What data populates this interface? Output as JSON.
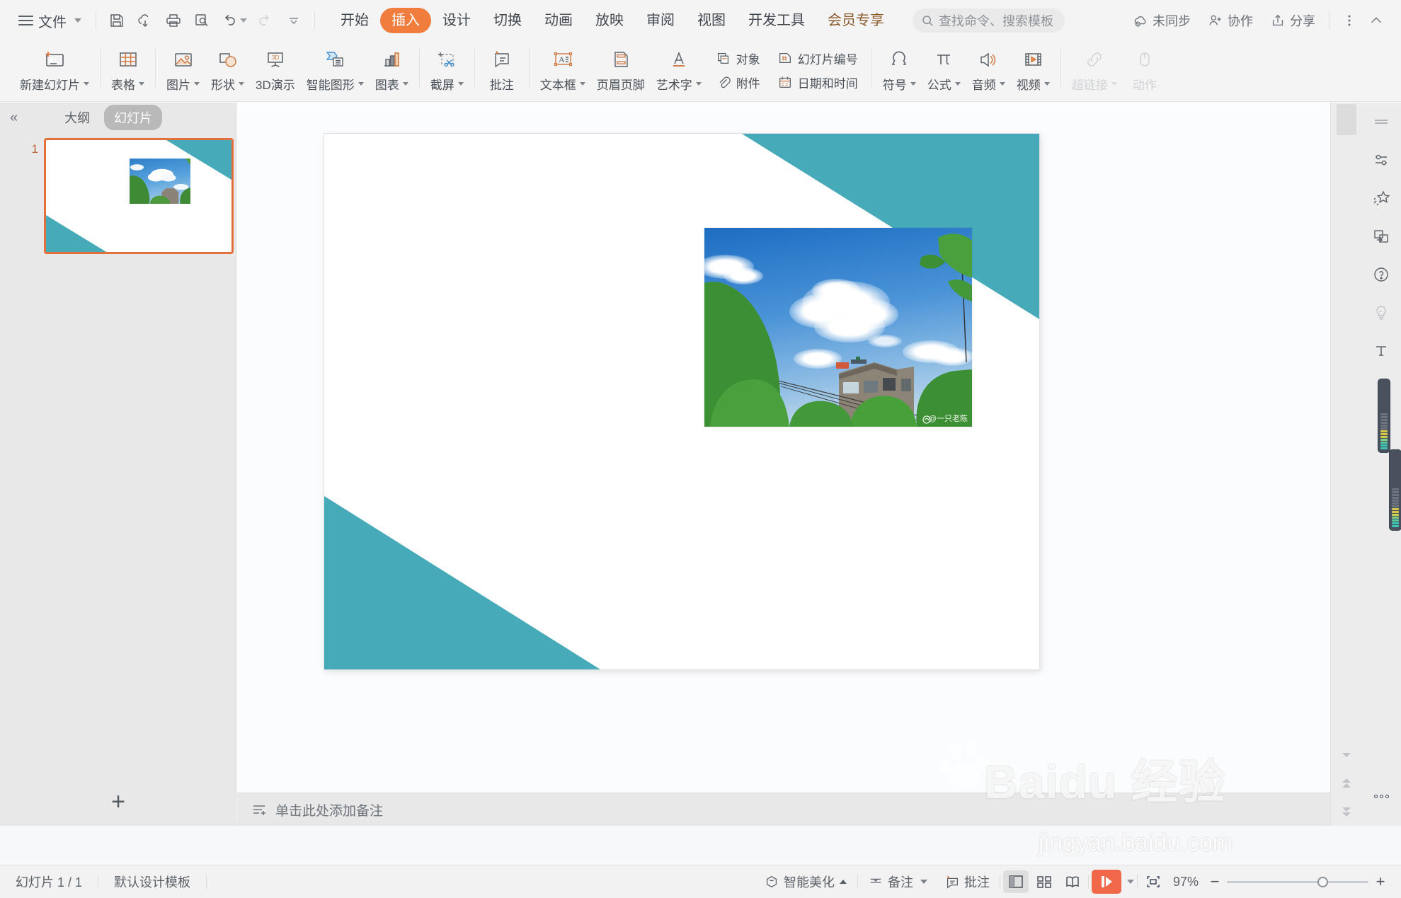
{
  "app": {
    "file_menu": "文件",
    "quick_access": [
      {
        "name": "save-button",
        "icon": "save-icon"
      },
      {
        "name": "save-as-cloud-button",
        "icon": "cloud-save-icon"
      },
      {
        "name": "print-button",
        "icon": "print-icon"
      },
      {
        "name": "print-preview-button",
        "icon": "print-preview-icon"
      },
      {
        "name": "undo-button",
        "icon": "undo-icon"
      },
      {
        "name": "redo-button",
        "icon": "redo-icon"
      },
      {
        "name": "customize-quick-access-button",
        "icon": "chevron-down-icon"
      }
    ]
  },
  "tabs": [
    {
      "label": "开始",
      "active": false
    },
    {
      "label": "插入",
      "active": true
    },
    {
      "label": "设计",
      "active": false
    },
    {
      "label": "切换",
      "active": false
    },
    {
      "label": "动画",
      "active": false
    },
    {
      "label": "放映",
      "active": false
    },
    {
      "label": "审阅",
      "active": false
    },
    {
      "label": "视图",
      "active": false
    },
    {
      "label": "开发工具",
      "active": false
    },
    {
      "label": "会员专享",
      "active": false,
      "vip": true
    }
  ],
  "search": {
    "placeholder": "查找命令、搜索模板"
  },
  "header_right": {
    "sync_status": "未同步",
    "collaborate": "协作",
    "share": "分享",
    "more": "更多",
    "collapse_ribbon": "收起功能区"
  },
  "ribbon": {
    "groups": [
      {
        "items": [
          {
            "label": "新建幻灯片",
            "icon": "new-slide-icon",
            "caret": true,
            "disabled": false
          }
        ]
      },
      {
        "items": [
          {
            "label": "表格",
            "icon": "table-icon",
            "caret": true,
            "disabled": false
          }
        ]
      },
      {
        "items": [
          {
            "label": "图片",
            "icon": "picture-icon",
            "caret": true,
            "disabled": false
          },
          {
            "label": "形状",
            "icon": "shape-icon",
            "caret": true,
            "disabled": false
          },
          {
            "label": "3D演示",
            "icon": "three-d-icon",
            "caret": false,
            "disabled": false
          },
          {
            "label": "智能图形",
            "icon": "smartart-icon",
            "caret": true,
            "disabled": false
          },
          {
            "label": "图表",
            "icon": "chart-icon",
            "caret": true,
            "disabled": false
          }
        ]
      },
      {
        "items": [
          {
            "label": "截屏",
            "icon": "screenshot-icon",
            "caret": true,
            "disabled": false
          }
        ]
      },
      {
        "items": [
          {
            "label": "批注",
            "icon": "comment-icon",
            "caret": false,
            "disabled": false
          }
        ]
      },
      {
        "items": [
          {
            "label": "文本框",
            "icon": "textbox-icon",
            "caret": true,
            "disabled": false
          },
          {
            "label": "页眉页脚",
            "icon": "header-footer-icon",
            "caret": false,
            "disabled": false
          },
          {
            "label": "艺术字",
            "icon": "wordart-icon",
            "caret": true,
            "disabled": false
          }
        ]
      },
      {
        "stack": [
          {
            "label": "对象",
            "icon": "object-icon"
          },
          {
            "label": "附件",
            "icon": "attachment-icon"
          }
        ]
      },
      {
        "stack": [
          {
            "label": "幻灯片编号",
            "icon": "slide-number-icon"
          },
          {
            "label": "日期和时间",
            "icon": "date-time-icon"
          }
        ]
      },
      {
        "items": [
          {
            "label": "符号",
            "icon": "symbol-icon",
            "caret": true,
            "disabled": false
          },
          {
            "label": "公式",
            "icon": "formula-icon",
            "caret": true,
            "disabled": false
          },
          {
            "label": "音频",
            "icon": "audio-icon",
            "caret": true,
            "disabled": false
          },
          {
            "label": "视频",
            "icon": "video-icon",
            "caret": true,
            "disabled": false
          }
        ]
      },
      {
        "items": [
          {
            "label": "超链接",
            "icon": "hyperlink-icon",
            "caret": true,
            "disabled": true
          },
          {
            "label": "动作",
            "icon": "action-mouse-icon",
            "caret": false,
            "disabled": true
          }
        ]
      }
    ]
  },
  "slide_panel": {
    "collapse": "«",
    "tab_outline": "大纲",
    "tab_slides": "幻灯片",
    "active_tab": "幻灯片",
    "thumbnails": [
      {
        "number": "1"
      }
    ],
    "add_slide": "+"
  },
  "slide": {
    "theme_accent": "#46aab8",
    "background": "#ffffff",
    "photo_watermark": "@一只老陈"
  },
  "notes": {
    "placeholder": "单击此处添加备注",
    "icon": "notes-icon"
  },
  "tool_rail": [
    {
      "name": "panel-handle",
      "icon": "drag-handle-icon",
      "dim": false
    },
    {
      "name": "properties-button",
      "icon": "sliders-icon",
      "dim": false
    },
    {
      "name": "beautify-button",
      "icon": "sparkle-star-icon",
      "dim": false
    },
    {
      "name": "replace-shape-button",
      "icon": "shape-replace-icon",
      "dim": false
    },
    {
      "name": "help-button",
      "icon": "question-circle-icon",
      "dim": false
    },
    {
      "name": "idea-button",
      "icon": "lightbulb-icon",
      "dim": true
    },
    {
      "name": "text-tool-button",
      "icon": "text-t-icon",
      "dim": false
    }
  ],
  "status_bar": {
    "slide_count": "幻灯片 1 / 1",
    "template": "默认设计模板",
    "beautify": "智能美化",
    "notes_btn": "备注",
    "comment_btn": "批注",
    "views": [
      {
        "name": "normal-view-button",
        "icon": "normal-view-icon",
        "active": true
      },
      {
        "name": "slide-sorter-button",
        "icon": "grid-view-icon",
        "active": false
      },
      {
        "name": "reading-view-button",
        "icon": "reading-view-icon",
        "active": false
      }
    ],
    "play_button": "放映",
    "fit_button": "适应窗口",
    "zoom_level": "97%",
    "zoom_out": "−",
    "zoom_in": "+"
  },
  "overlay_watermark": {
    "line1": "Baidu 经验",
    "line2": "jingyan.baidu.com"
  }
}
